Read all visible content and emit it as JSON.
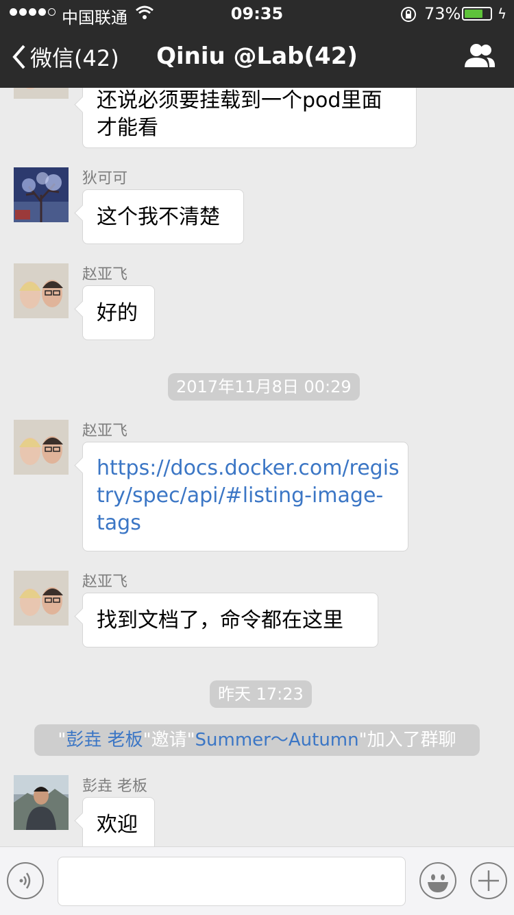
{
  "statusbar": {
    "carrier": "中国联通",
    "time": "09:35",
    "battery_pct_label": "73%",
    "battery_level": 0.73
  },
  "navbar": {
    "back_label": "微信(42)",
    "title": "Qiniu @Lab(42)"
  },
  "messages": [
    {
      "sender": "",
      "lines": [
        "还说必须要挂载到一个pod里面",
        "才能看"
      ]
    },
    {
      "sender": "狄可可",
      "lines": [
        "这个我不清楚"
      ]
    },
    {
      "sender": "赵亚飞",
      "lines": [
        "好的"
      ]
    },
    {
      "sender": "赵亚飞",
      "lines": [
        "https://docs.docker.com/regis",
        "try/spec/api/#listing-image-",
        "tags"
      ]
    },
    {
      "sender": "赵亚飞",
      "lines": [
        "找到文档了，命令都在这里"
      ]
    },
    {
      "sender": "彭垚 老板",
      "lines": [
        "欢迎"
      ]
    }
  ],
  "timestamps": [
    "2017年11月8日 00:29",
    "昨天 17:23"
  ],
  "system_message": {
    "q1": "\"",
    "inviter": "彭垚 老板",
    "mid": "\"邀请\"",
    "invitee": "Summer～Autumn",
    "end": "\"加入了群聊"
  },
  "colors": {
    "bar_bg": "#2b2b2b",
    "chat_bg": "#ebebeb",
    "link": "#3b76c5",
    "battery": "#5ec33a"
  },
  "icons": [
    "signal-dots-icon",
    "wifi-icon",
    "lock-rotation-icon",
    "battery-icon",
    "charging-bolt-icon",
    "back-chevron-icon",
    "group-people-icon",
    "voice-icon",
    "emoji-icon",
    "plus-icon"
  ]
}
